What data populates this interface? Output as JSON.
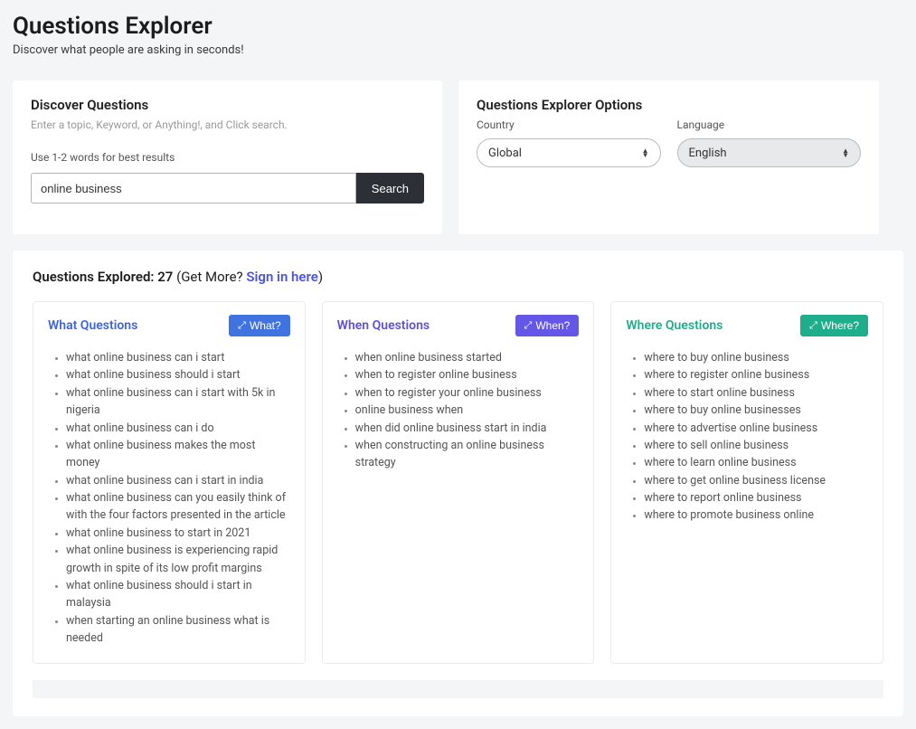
{
  "page": {
    "title": "Questions Explorer",
    "subtitle": "Discover what people are asking in seconds!"
  },
  "discover": {
    "title": "Discover Questions",
    "sub": "Enter a topic, Keyword, or Anything!, and Click search.",
    "hint": "Use 1-2 words for best results",
    "search_value": "online business",
    "search_btn": "Search"
  },
  "options": {
    "title": "Questions Explorer Options",
    "country_label": "Country",
    "country_value": "Global",
    "language_label": "Language",
    "language_value": "English"
  },
  "results": {
    "prefix": "Questions Explored: ",
    "count": "27",
    "getmore": " (Get More? ",
    "sign_link": "Sign in here",
    "tail": ")"
  },
  "cards": {
    "what": {
      "title": "What Questions",
      "btn": "What?",
      "items": [
        "what online business can i start",
        "what online business should i start",
        "what online business can i start with 5k in nigeria",
        "what online business can i do",
        "what online business makes the most money",
        "what online business can i start in india",
        "what online business can you easily think of with the four factors presented in the article",
        "what online business to start in 2021",
        "what online business is experiencing rapid growth in spite of its low profit margins",
        "what online business should i start in malaysia",
        "when starting an online business what is needed"
      ]
    },
    "when": {
      "title": "When Questions",
      "btn": "When?",
      "items": [
        "when online business started",
        "when to register online business",
        "when to register your online business",
        "online business when",
        "when did online business start in india",
        "when constructing an online business strategy"
      ]
    },
    "where": {
      "title": "Where Questions",
      "btn": "Where?",
      "items": [
        "where to buy online business",
        "where to register online business",
        "where to start online business",
        "where to buy online businesses",
        "where to advertise online business",
        "where to sell online business",
        "where to learn online business",
        "where to get online business license",
        "where to report online business",
        "where to promote business online"
      ]
    }
  }
}
